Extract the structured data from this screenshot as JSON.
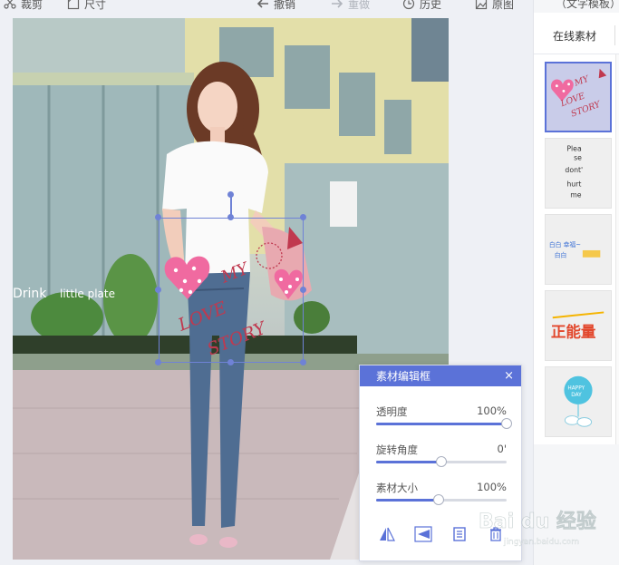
{
  "toolbar": {
    "crop_label": "裁剪",
    "size_label": "尺寸",
    "undo_label": "撤销",
    "redo_label": "重做",
    "history_label": "历史",
    "original_label": "原图"
  },
  "right_panel": {
    "header_label": "（文字模板）",
    "tab_online": "在线素材",
    "thumbnails": [
      {
        "name": "thumb-my-love-story",
        "text_lines": [
          "MY",
          "LOVE",
          "STORY"
        ],
        "selected": true
      },
      {
        "name": "thumb-please-dont-hurt-me",
        "text_lines": [
          "Plea",
          "se",
          "dont'",
          "hurt",
          "me"
        ],
        "selected": false
      },
      {
        "name": "thumb-chinese-text-sticker",
        "text_lines": [
          "白白 幸福~",
          "白白"
        ],
        "selected": false
      },
      {
        "name": "thumb-zhengneng-sticker",
        "text_lines": [
          "正能量"
        ],
        "selected": false
      },
      {
        "name": "thumb-happy-day",
        "text_lines": [
          "HAPPY",
          "DAY"
        ],
        "selected": false
      }
    ]
  },
  "photo": {
    "shop_text_1": "Drink",
    "shop_text_2": "little plate",
    "sticker_text": [
      "MY",
      "LOVE",
      "STORY"
    ]
  },
  "dialog": {
    "title": "素材编辑框",
    "close_glyph": "×",
    "opacity_label": "透明度",
    "opacity_value": "100%",
    "opacity_level": 1.0,
    "rotation_label": "旋转角度",
    "rotation_value": "0'",
    "rotation_level": 0.5,
    "size_label": "素材大小",
    "size_value": "100%",
    "size_level": 0.48,
    "tools": [
      "flip-horizontal-icon",
      "flip-vertical-icon",
      "layer-icon",
      "delete-icon"
    ]
  },
  "watermark": {
    "text": "Bai du 经验",
    "url": "jingyan.baidu.com"
  },
  "colors": {
    "accent": "#5b72d8",
    "selection": "#6f82d6",
    "sticker_pink": "#f06aa0",
    "sticker_text": "#c0394f"
  }
}
